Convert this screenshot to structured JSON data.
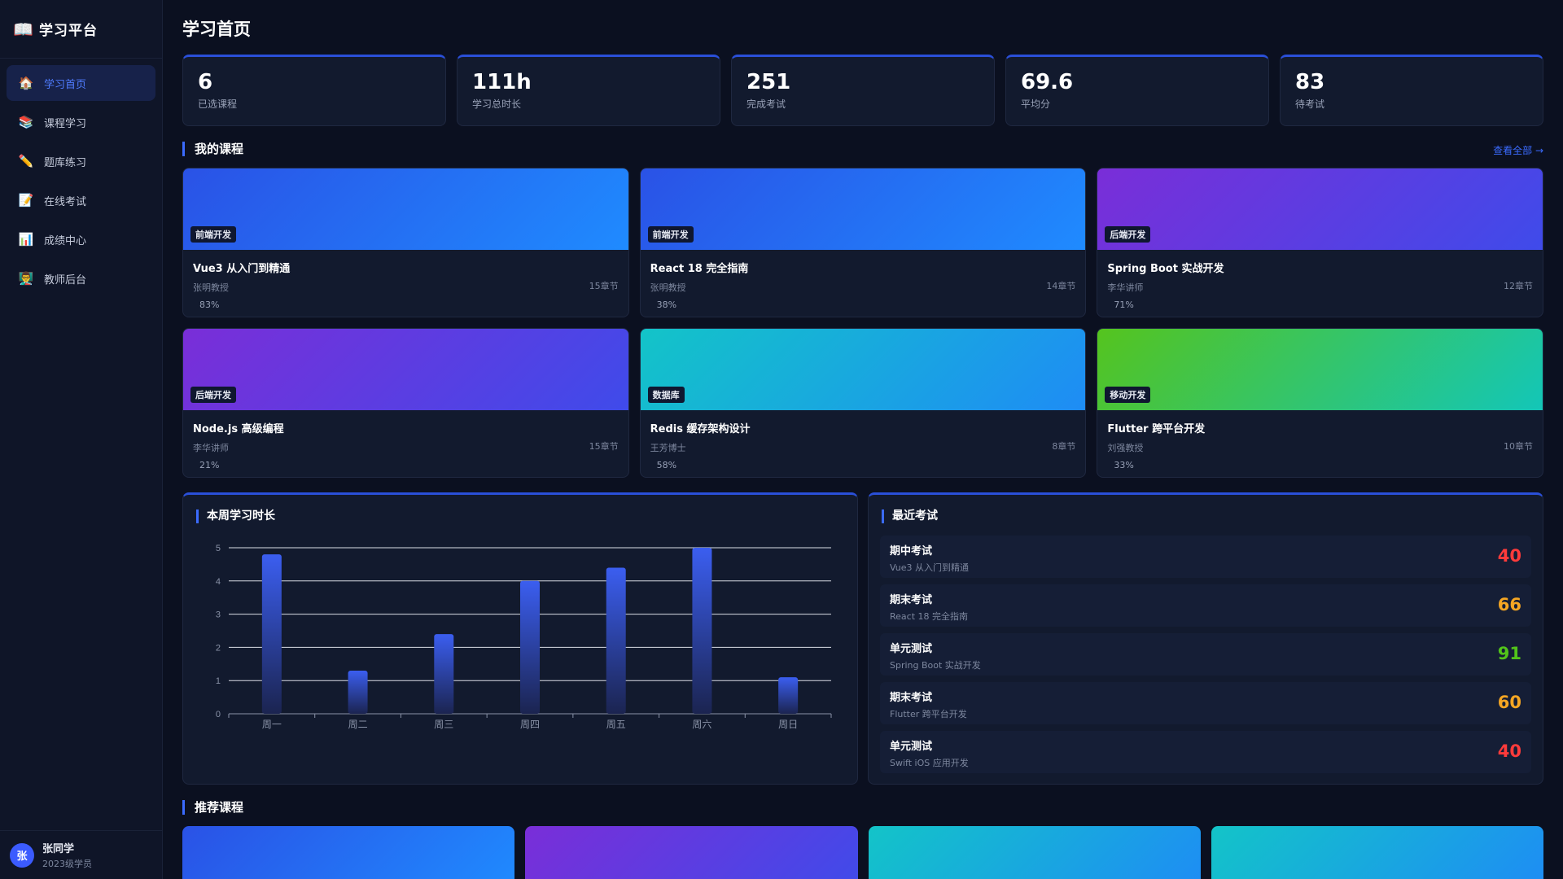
{
  "brand": {
    "title": "学习平台",
    "icon": "open-book-icon"
  },
  "sidebar": {
    "items": [
      {
        "label": "学习首页",
        "icon": "house-icon",
        "active": true
      },
      {
        "label": "课程学习",
        "icon": "books-icon",
        "active": false
      },
      {
        "label": "题库练习",
        "icon": "pencil-icon",
        "active": false
      },
      {
        "label": "在线考试",
        "icon": "memo-icon",
        "active": false
      },
      {
        "label": "成绩中心",
        "icon": "bar-chart-icon",
        "active": false
      },
      {
        "label": "教师后台",
        "icon": "teacher-icon",
        "active": false
      }
    ]
  },
  "user": {
    "avatar_text": "张",
    "name": "张同学",
    "subtitle": "2023级学员"
  },
  "page": {
    "title": "学习首页"
  },
  "stats": [
    {
      "value": "6",
      "label": "已选课程"
    },
    {
      "value": "111h",
      "label": "学习总时长"
    },
    {
      "value": "251",
      "label": "完成考试"
    },
    {
      "value": "69.6",
      "label": "平均分"
    },
    {
      "value": "83",
      "label": "待考试"
    }
  ],
  "my_courses": {
    "title": "我的课程",
    "view_all": "查看全部 →",
    "items": [
      {
        "tag": "前端开发",
        "name": "Vue3 从入门到精通",
        "teacher": "张明教授",
        "chapters": "15章节",
        "progress": "83%",
        "gradient": [
          "#2a52e6",
          "#1f8bff"
        ]
      },
      {
        "tag": "前端开发",
        "name": "React 18 完全指南",
        "teacher": "张明教授",
        "chapters": "14章节",
        "progress": "38%",
        "gradient": [
          "#2a52e6",
          "#1f8bff"
        ]
      },
      {
        "tag": "后端开发",
        "name": "Spring Boot 实战开发",
        "teacher": "李华讲师",
        "chapters": "12章节",
        "progress": "71%",
        "gradient": [
          "#7a2ed8",
          "#3f4bea"
        ]
      },
      {
        "tag": "后端开发",
        "name": "Node.js 高级编程",
        "teacher": "李华讲师",
        "chapters": "15章节",
        "progress": "21%",
        "gradient": [
          "#7a2ed8",
          "#3f4bea"
        ]
      },
      {
        "tag": "数据库",
        "name": "Redis 缓存架构设计",
        "teacher": "王芳博士",
        "chapters": "8章节",
        "progress": "58%",
        "gradient": [
          "#13c4c8",
          "#1e8cf5"
        ]
      },
      {
        "tag": "移动开发",
        "name": "Flutter 跨平台开发",
        "teacher": "刘强教授",
        "chapters": "10章节",
        "progress": "33%",
        "gradient": [
          "#55c41e",
          "#13c6b8"
        ]
      }
    ]
  },
  "weekly": {
    "title": "本周学习时长",
    "chart_data": {
      "type": "bar",
      "categories": [
        "周一",
        "周二",
        "周三",
        "周四",
        "周五",
        "周六",
        "周日"
      ],
      "values": [
        4.8,
        1.3,
        2.4,
        4.0,
        4.4,
        5.0,
        1.1
      ],
      "ylim": [
        0,
        5
      ],
      "yticks": [
        "0",
        "1",
        "2",
        "3",
        "4",
        "5"
      ],
      "grid": true,
      "bar_color": "#3b5ef0"
    }
  },
  "exams": {
    "title": "最近考试",
    "items": [
      {
        "name": "期中考试",
        "course": "Vue3 从入门到精通",
        "score": "40",
        "color": "#ff3b3b"
      },
      {
        "name": "期末考试",
        "course": "React 18 完全指南",
        "score": "66",
        "color": "#f5a623"
      },
      {
        "name": "单元测试",
        "course": "Spring Boot 实战开发",
        "score": "91",
        "color": "#52c41a"
      },
      {
        "name": "期末考试",
        "course": "Flutter 跨平台开发",
        "score": "60",
        "color": "#f5a623"
      },
      {
        "name": "单元测试",
        "course": "Swift iOS 应用开发",
        "score": "40",
        "color": "#ff3b3b"
      }
    ]
  },
  "recommended": {
    "title": "推荐课程",
    "items": [
      {
        "gradient": [
          "#2a52e6",
          "#1f8bff"
        ]
      },
      {
        "gradient": [
          "#7a2ed8",
          "#3f4bea"
        ]
      },
      {
        "gradient": [
          "#13c4c8",
          "#1e8cf5"
        ]
      },
      {
        "gradient": [
          "#13c4c8",
          "#1e8cf5"
        ]
      }
    ]
  }
}
